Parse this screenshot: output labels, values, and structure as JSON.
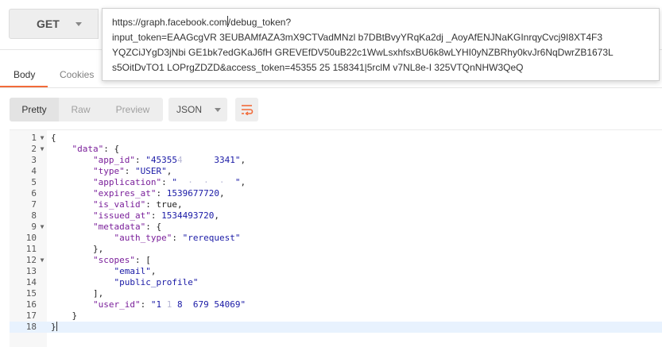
{
  "request": {
    "method": "GET",
    "url_lines": [
      "https://graph.facebook.com/debug_token?",
      "input_token=EAAGcgVR  3EUBAMfAZA3mX9CTVadMNzl  b7DBtBvyYRqKa2dj   _AoyAfENJNaKGInrqyCvcj9I8XT4F3",
      "YQZCiJYgD3jNbi    GE1bk7edGKaJ6fH   GREVEfDV50uB22c1WwLsxhfsxBU6k8wLYHI0yNZBRhy0kvJr6NqDwrZB1673L",
      "s5OitDvTO1     LOPrgZDZD&access_token=45355  25  158341|5rclM  v7NL8e-I  325VTQnNHW3QeQ"
    ]
  },
  "tabs": [
    {
      "label": "Body",
      "active": true
    },
    {
      "label": "Cookies",
      "active": false
    }
  ],
  "view_options": [
    "Pretty",
    "Raw",
    "Preview"
  ],
  "active_view": "Pretty",
  "format": "JSON",
  "code_lines": [
    {
      "n": "1",
      "fold": "▼",
      "segs": [
        [
          "p",
          "{"
        ]
      ]
    },
    {
      "n": "2",
      "fold": "▼",
      "segs": [
        [
          "p",
          "    "
        ],
        [
          "k",
          "\"data\""
        ],
        [
          "p",
          ": {"
        ]
      ]
    },
    {
      "n": "3",
      "fold": "",
      "segs": [
        [
          "p",
          "        "
        ],
        [
          "k",
          "\"app_id\""
        ],
        [
          "p",
          ": "
        ],
        [
          "s",
          "\"45355"
        ],
        [
          "blur",
          "4      "
        ],
        [
          "s",
          "3341\""
        ],
        [
          "p",
          ","
        ]
      ]
    },
    {
      "n": "4",
      "fold": "",
      "segs": [
        [
          "p",
          "        "
        ],
        [
          "k",
          "\"type\""
        ],
        [
          "p",
          ": "
        ],
        [
          "s",
          "\"USER\""
        ],
        [
          "p",
          ","
        ]
      ]
    },
    {
      "n": "5",
      "fold": "",
      "segs": [
        [
          "p",
          "        "
        ],
        [
          "k",
          "\"application\""
        ],
        [
          "p",
          ": "
        ],
        [
          "s",
          "\""
        ],
        [
          "blur",
          "  ·  ·  ·  "
        ],
        [
          "s",
          "\""
        ],
        [
          "p",
          ","
        ]
      ]
    },
    {
      "n": "6",
      "fold": "",
      "segs": [
        [
          "p",
          "        "
        ],
        [
          "k",
          "\"expires_at\""
        ],
        [
          "p",
          ": "
        ],
        [
          "n",
          "1539677720"
        ],
        [
          "p",
          ","
        ]
      ]
    },
    {
      "n": "7",
      "fold": "",
      "segs": [
        [
          "p",
          "        "
        ],
        [
          "k",
          "\"is_valid\""
        ],
        [
          "p",
          ": "
        ],
        [
          "b",
          "true"
        ],
        [
          "p",
          ","
        ]
      ]
    },
    {
      "n": "8",
      "fold": "",
      "segs": [
        [
          "p",
          "        "
        ],
        [
          "k",
          "\"issued_at\""
        ],
        [
          "p",
          ": "
        ],
        [
          "n",
          "1534493720"
        ],
        [
          "p",
          ","
        ]
      ]
    },
    {
      "n": "9",
      "fold": "▼",
      "segs": [
        [
          "p",
          "        "
        ],
        [
          "k",
          "\"metadata\""
        ],
        [
          "p",
          ": {"
        ]
      ]
    },
    {
      "n": "10",
      "fold": "",
      "segs": [
        [
          "p",
          "            "
        ],
        [
          "k",
          "\"auth_type\""
        ],
        [
          "p",
          ": "
        ],
        [
          "s",
          "\"rerequest\""
        ]
      ]
    },
    {
      "n": "11",
      "fold": "",
      "segs": [
        [
          "p",
          "        },"
        ]
      ]
    },
    {
      "n": "12",
      "fold": "▼",
      "segs": [
        [
          "p",
          "        "
        ],
        [
          "k",
          "\"scopes\""
        ],
        [
          "p",
          ": ["
        ]
      ]
    },
    {
      "n": "13",
      "fold": "",
      "segs": [
        [
          "p",
          "            "
        ],
        [
          "s",
          "\"email\""
        ],
        [
          "p",
          ","
        ]
      ]
    },
    {
      "n": "14",
      "fold": "",
      "segs": [
        [
          "p",
          "            "
        ],
        [
          "s",
          "\"public_profile\""
        ]
      ]
    },
    {
      "n": "15",
      "fold": "",
      "segs": [
        [
          "p",
          "        ],"
        ]
      ]
    },
    {
      "n": "16",
      "fold": "",
      "segs": [
        [
          "p",
          "        "
        ],
        [
          "k",
          "\"user_id\""
        ],
        [
          "p",
          ": "
        ],
        [
          "s",
          "\"1"
        ],
        [
          "blur",
          " 1 "
        ],
        [
          "s",
          "8"
        ],
        [
          "blur",
          "  "
        ],
        [
          "s",
          "679"
        ],
        [
          "blur",
          " "
        ],
        [
          "s",
          "54069\""
        ]
      ]
    },
    {
      "n": "17",
      "fold": "",
      "segs": [
        [
          "p",
          "    }"
        ]
      ]
    },
    {
      "n": "18",
      "fold": "",
      "segs": [
        [
          "p",
          "}"
        ]
      ]
    }
  ],
  "active_line": 18
}
